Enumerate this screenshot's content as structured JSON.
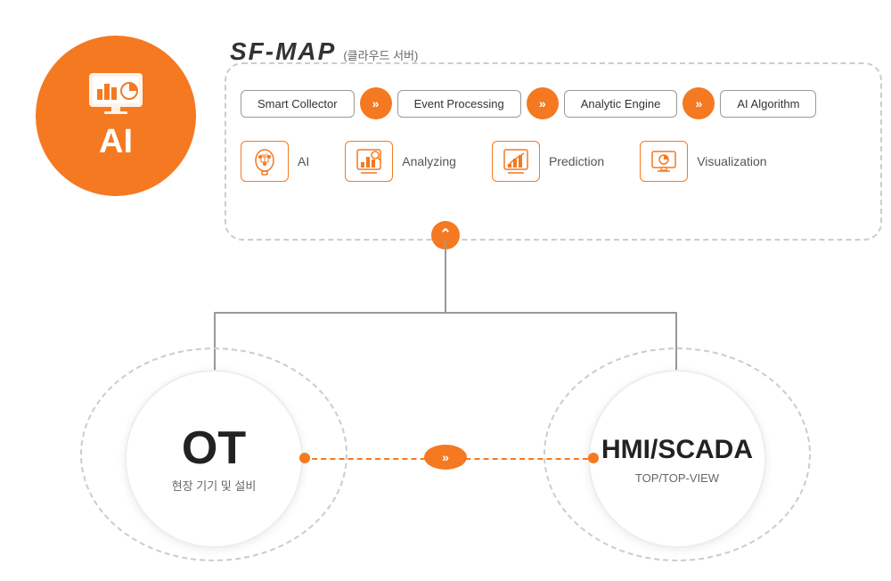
{
  "header": {
    "logo": "SF-MAP",
    "subtitle": "(클라우드 서버)"
  },
  "pipeline": {
    "items": [
      {
        "label": "Smart Collector"
      },
      {
        "label": "Event Processing"
      },
      {
        "label": "Analytic Engine"
      },
      {
        "label": "AI Algorithm"
      }
    ],
    "arrow": "»"
  },
  "features": [
    {
      "icon": "ai-brain-icon",
      "label": "AI"
    },
    {
      "icon": "analyzing-chart-icon",
      "label": "Analyzing"
    },
    {
      "icon": "prediction-chart-icon",
      "label": "Prediction"
    },
    {
      "icon": "visualization-chart-icon",
      "label": "Visualization"
    }
  ],
  "ai_circle": {
    "label": "AI"
  },
  "ot_node": {
    "main_label": "OT",
    "sub_label": "현장 기기 및 설비"
  },
  "hmi_node": {
    "main_label": "HMI/SCADA",
    "sub_label": "TOP/TOP-VIEW"
  },
  "connector_arrow": "⌃",
  "arrows": {
    "double": "»",
    "up": "⌃"
  },
  "colors": {
    "orange": "#f47920",
    "dark": "#222",
    "gray": "#999",
    "light_gray": "#ccc"
  }
}
